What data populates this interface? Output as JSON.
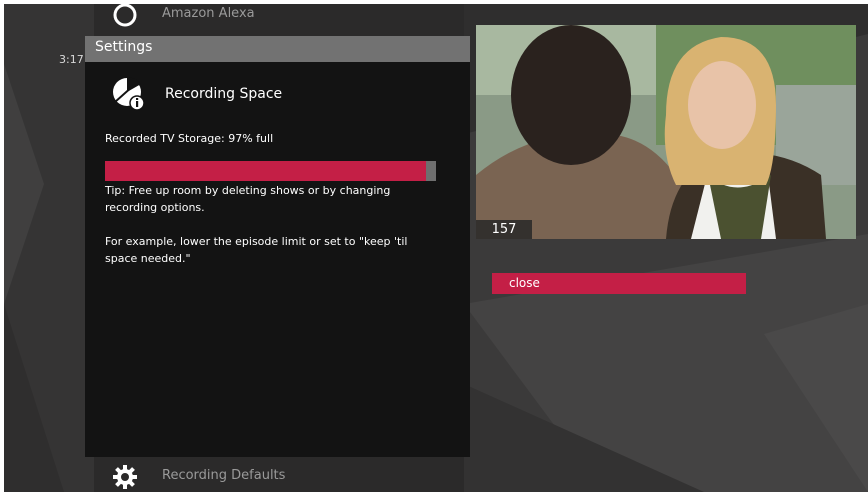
{
  "clock": "3:17",
  "menu": {
    "top_item": {
      "label": "Amazon Alexa",
      "icon": "alexa-ring-icon"
    },
    "bottom_item": {
      "label": "Recording Defaults",
      "icon": "gear-icon"
    }
  },
  "dialog": {
    "title": "Settings",
    "section_title": "Recording Space",
    "section_icon": "recording-space-info-icon",
    "storage_label": "Recorded TV Storage: 97% full",
    "storage_percent": 97,
    "tip": "Tip: Free up room by deleting shows or by changing recording options.",
    "example": "For example, lower the episode limit or set to \"keep 'til space needed.\""
  },
  "preview": {
    "channel": "157"
  },
  "actions": {
    "close_label": "close"
  },
  "colors": {
    "accent": "#c41f46",
    "header": "#727272",
    "dialog_bg": "#131313"
  }
}
